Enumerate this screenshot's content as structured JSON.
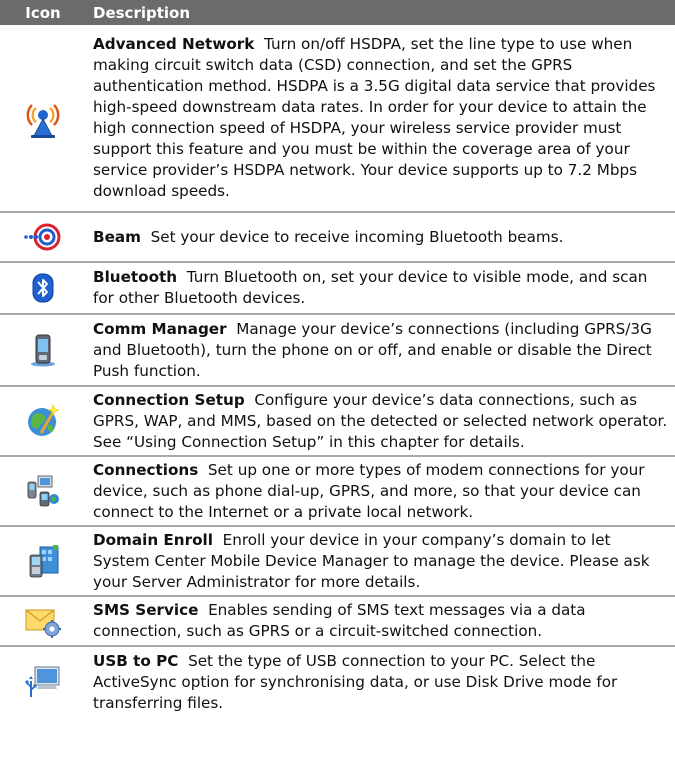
{
  "header": {
    "icon": "Icon",
    "description": "Description"
  },
  "rows": [
    {
      "icon": "advanced-network-icon",
      "title": "Advanced Network",
      "text": "Turn on/off HSDPA, set the line type to use when making circuit switch data (CSD) connection, and set the GPRS authentication method. HSDPA is a 3.5G digital data service that provides high-speed downstream data rates. In order for your device to attain the high connection speed of HSDPA, your wireless service provider must support this feature and you must be within the coverage area of your service provider’s HSDPA network. Your device supports up to 7.2 Mbps download speeds."
    },
    {
      "icon": "beam-icon",
      "title": "Beam",
      "text": "Set your device to receive incoming Bluetooth beams."
    },
    {
      "icon": "bluetooth-icon",
      "title": "Bluetooth",
      "text": "Turn Bluetooth on, set your device to visible mode, and scan for other Bluetooth devices."
    },
    {
      "icon": "comm-manager-icon",
      "title": "Comm Manager",
      "text": "Manage your device’s connections (including GPRS/3G and Bluetooth), turn the phone on or off, and enable or disable the Direct Push function."
    },
    {
      "icon": "connection-setup-icon",
      "title": "Connection Setup",
      "text": "Configure your device’s data connections, such as GPRS, WAP, and MMS, based on the detected or selected network operator. See “Using Connection Setup” in this chapter for details."
    },
    {
      "icon": "connections-icon",
      "title": "Connections",
      "text": "Set up one or more types of modem connections for your device, such as phone dial-up, GPRS, and more, so that your device can connect to the Internet or a private local network."
    },
    {
      "icon": "domain-enroll-icon",
      "title": "Domain Enroll",
      "text": "Enroll your device in your company’s domain to let System Center Mobile Device Manager to manage the device. Please ask your Server Administrator for more details."
    },
    {
      "icon": "sms-service-icon",
      "title": "SMS Service",
      "text": "Enables sending of SMS text messages via a data connection, such as GPRS or a circuit-switched connection."
    },
    {
      "icon": "usb-to-pc-icon",
      "title": "USB to PC",
      "text": "Set the type of USB connection to your PC. Select the ActiveSync option for synchronising data, or use Disk Drive mode for transferring files."
    }
  ]
}
